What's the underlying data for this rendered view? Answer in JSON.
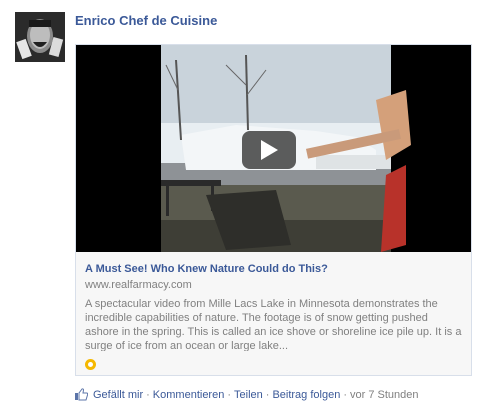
{
  "post": {
    "author": "Enrico Chef de Cuisine"
  },
  "attachment": {
    "title": "A Must See! Who Knew Nature Could do This?",
    "domain": "www.realfarmacy.com",
    "description": "A spectacular video from Mille Lacs Lake in Minnesota demonstrates the incredible capabilities of nature.  The footage is of snow getting pushed ashore in the spring.  This is called an ice shove or shoreline ice pile up.  It is a surge of ice from an ocean or large lake..."
  },
  "actions": {
    "like": "Gefällt mir",
    "sep": "·",
    "comment": "Kommentieren",
    "share": "Teilen",
    "follow": "Beitrag folgen",
    "time": "vor 7 Stunden"
  },
  "colors": {
    "link": "#3b5998",
    "muted": "#808080",
    "card_border": "#d8dfea"
  }
}
